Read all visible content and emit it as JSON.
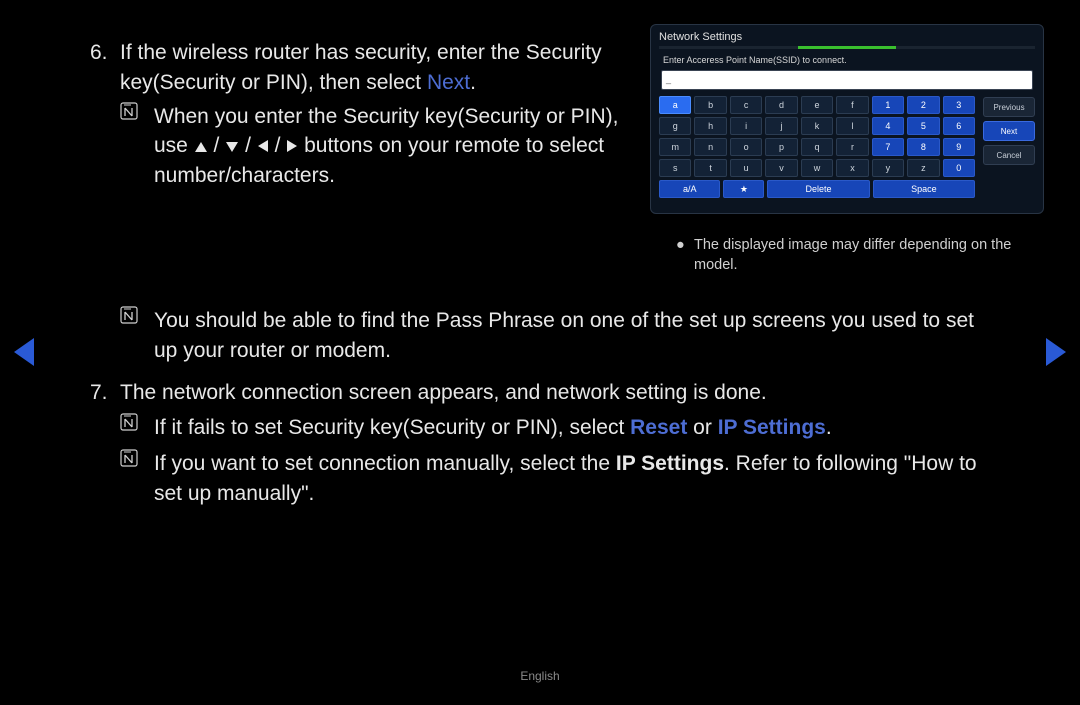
{
  "steps": {
    "s6_num": "6.",
    "s6_text_a": "If the wireless router has security, enter the Security key(Security or PIN), then select ",
    "s6_next": "Next",
    "s6_text_b": ".",
    "s6_note1_a": "When you enter the Security key(Security or PIN), use ",
    "s6_note1_b": " buttons on your remote to select number/characters.",
    "s6_note2": "You should be able to find the Pass Phrase on one of the set up screens you used to set up your router or modem.",
    "s7_num": "7.",
    "s7_text": "The network connection screen appears, and network setting is done.",
    "s7_note1_a": "If it fails to set Security key(Security or PIN), select ",
    "s7_reset": "Reset",
    "s7_or": " or ",
    "s7_ip": "IP Settings",
    "s7_note1_b": ".",
    "s7_note2_a": "If you want to set connection manually, select the ",
    "s7_note2_b": ". Refer to following \"How to set up manually\"."
  },
  "note_glyph": "N",
  "slash": " / ",
  "panel": {
    "title": "Network Settings",
    "prompt": "Enter Acceress Point Name(SSID) to connect.",
    "cursor": "_",
    "keys_row1": [
      "a",
      "b",
      "c",
      "d",
      "e",
      "f",
      "1",
      "2",
      "3"
    ],
    "keys_row2": [
      "g",
      "h",
      "i",
      "j",
      "k",
      "l",
      "4",
      "5",
      "6"
    ],
    "keys_row3": [
      "m",
      "n",
      "o",
      "p",
      "q",
      "r",
      "7",
      "8",
      "9"
    ],
    "keys_row4": [
      "s",
      "t",
      "u",
      "v",
      "w",
      "x",
      "y",
      "z",
      "0"
    ],
    "fn": {
      "case": "a/A",
      "star": "★",
      "delete": "Delete",
      "space": "Space"
    },
    "side": {
      "prev": "Previous",
      "next": "Next",
      "cancel": "Cancel"
    }
  },
  "caption": "The displayed image may differ depending on the model.",
  "footer": "English"
}
